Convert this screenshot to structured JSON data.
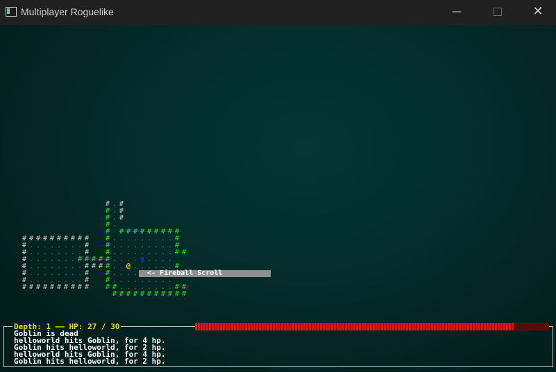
{
  "window": {
    "title": "Multiplayer Roguelike",
    "min_glyph": "—",
    "close_glyph": "✕"
  },
  "map": {
    "glyphs": {
      "wall": "#",
      "floor": ".",
      "player": "@",
      "monster": "g",
      "item": ")"
    },
    "colors": {
      "wall_explored": "#a9a9a9",
      "wall_visible": "#18c818",
      "player": "#e8e000",
      "monster": "#2030b8",
      "item_bg": "#d000b0"
    }
  },
  "tooltip": {
    "text": "<- Fireball Scroll"
  },
  "status": {
    "depth_label": "Depth: 1",
    "hp_label": "HP: 27 / 30",
    "hp_current": 27,
    "hp_max": 30
  },
  "log": [
    "Goblin is dead",
    "helloworld hits Goblin, for 4 hp.",
    "Goblin hits helloworld, for 2 hp.",
    "helloworld hits Goblin, for 4 hp.",
    "Goblin hits helloworld, for 2 hp."
  ]
}
